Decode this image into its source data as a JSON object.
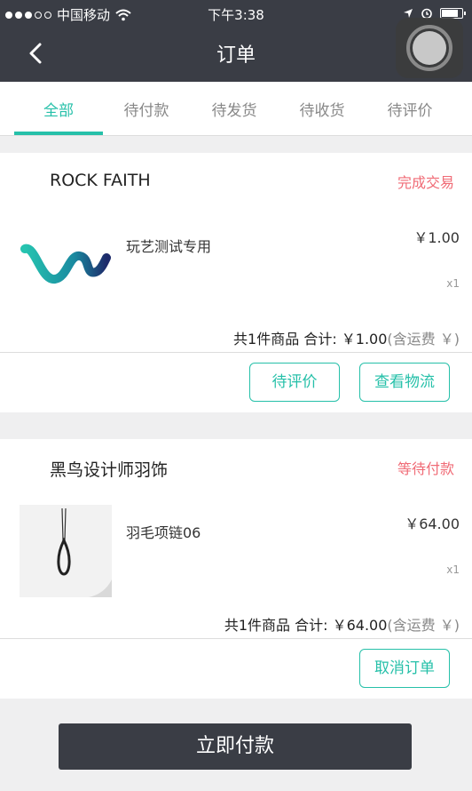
{
  "status_bar": {
    "carrier": "中国移动",
    "time": "下午3:38"
  },
  "nav": {
    "title": "订单"
  },
  "tabs": [
    {
      "label": "全部",
      "active": true
    },
    {
      "label": "待付款",
      "active": false
    },
    {
      "label": "待发货",
      "active": false
    },
    {
      "label": "待收货",
      "active": false
    },
    {
      "label": "待评价",
      "active": false
    }
  ],
  "orders": [
    {
      "shop": "ROCK FAITH",
      "status": "完成交易",
      "product_name": "玩艺测试专用",
      "price": "￥1.00",
      "qty": "x1",
      "summary_main": "共1件商品  合计: ￥1.00",
      "summary_note": "(含运费 ￥)",
      "buttons": [
        "待评价",
        "查看物流"
      ]
    },
    {
      "shop": "黑鸟设计师羽饰",
      "status": "等待付款",
      "product_name": "羽毛项链06",
      "price": "￥64.00",
      "qty": "x1",
      "summary_main": "共1件商品  合计: ￥64.00",
      "summary_note": "(含运费 ￥)",
      "buttons": [
        "取消订单"
      ]
    }
  ],
  "footer": {
    "pay_label": "立即付款"
  },
  "colors": {
    "accent": "#26c0a9",
    "header_bg": "#3a3d45",
    "status_red": "#f06b76"
  }
}
